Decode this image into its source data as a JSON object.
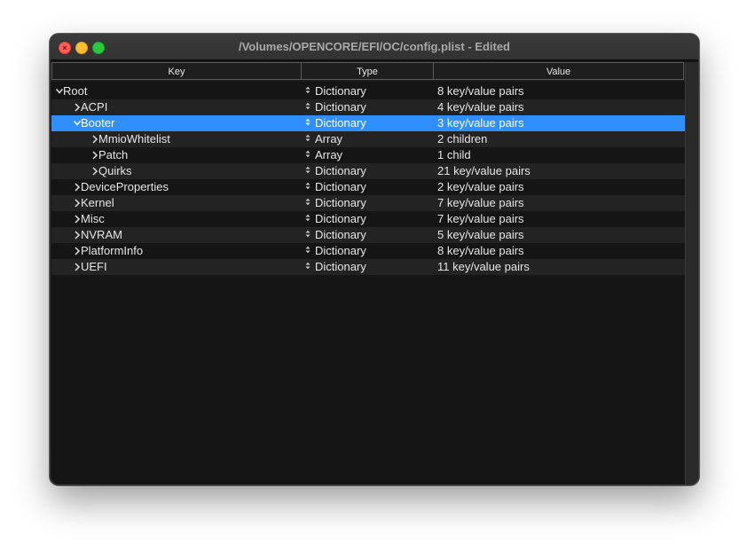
{
  "window": {
    "title": "/Volumes/OPENCORE/EFI/OC/config.plist - Edited"
  },
  "columns": {
    "key": "Key",
    "type": "Type",
    "value": "Value"
  },
  "rows": [
    {
      "key": "Root",
      "type": "Dictionary",
      "value": "8 key/value pairs",
      "expanded": true,
      "level": 0
    },
    {
      "key": "ACPI",
      "type": "Dictionary",
      "value": "4 key/value pairs",
      "expanded": false,
      "level": 1
    },
    {
      "key": "Booter",
      "type": "Dictionary",
      "value": "3 key/value pairs",
      "expanded": true,
      "level": 1,
      "selected": true
    },
    {
      "key": "MmioWhitelist",
      "type": "Array",
      "value": "2 children",
      "expanded": false,
      "level": 2
    },
    {
      "key": "Patch",
      "type": "Array",
      "value": "1 child",
      "expanded": false,
      "level": 2
    },
    {
      "key": "Quirks",
      "type": "Dictionary",
      "value": "21 key/value pairs",
      "expanded": false,
      "level": 2
    },
    {
      "key": "DeviceProperties",
      "type": "Dictionary",
      "value": "2 key/value pairs",
      "expanded": false,
      "level": 1
    },
    {
      "key": "Kernel",
      "type": "Dictionary",
      "value": "7 key/value pairs",
      "expanded": false,
      "level": 1
    },
    {
      "key": "Misc",
      "type": "Dictionary",
      "value": "7 key/value pairs",
      "expanded": false,
      "level": 1
    },
    {
      "key": "NVRAM",
      "type": "Dictionary",
      "value": "5 key/value pairs",
      "expanded": false,
      "level": 1
    },
    {
      "key": "PlatformInfo",
      "type": "Dictionary",
      "value": "8 key/value pairs",
      "expanded": false,
      "level": 1
    },
    {
      "key": "UEFI",
      "type": "Dictionary",
      "value": "11 key/value pairs",
      "expanded": false,
      "level": 1
    }
  ],
  "icons": {
    "close": "close-icon",
    "minimize": "minimize-icon",
    "maximize": "maximize-icon",
    "expanded": "chevron-down-icon",
    "collapsed": "chevron-right-icon",
    "type_popup": "up-down-arrows-icon"
  },
  "colors": {
    "selection": "#2f8ffd",
    "close": "#fe5f57",
    "minimize": "#febc2e",
    "maximize": "#28c840"
  }
}
